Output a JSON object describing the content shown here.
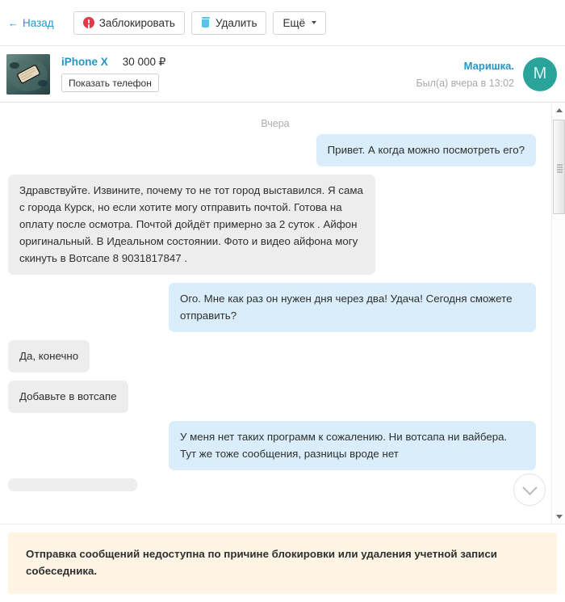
{
  "toolbar": {
    "back_label": "← Назад",
    "back_arrow": "←",
    "back_text": "Назад",
    "block_label": "Заблокировать",
    "delete_label": "Удалить",
    "more_label": "Ещё",
    "block_icon": "block-circle-icon",
    "delete_icon": "trash-icon",
    "more_icon": "chevron-down-icon"
  },
  "item": {
    "thumbnail_alt": "iPhone X photo",
    "title": "iPhone X",
    "price": "30 000 ₽",
    "show_phone_label": "Показать телефон"
  },
  "user": {
    "name": "Маришка.",
    "last_seen": "Был(а) вчера в 13:02",
    "avatar_initial": "M",
    "avatar_color": "#2aa39a"
  },
  "chat": {
    "day_separator": "Вчера",
    "messages": [
      {
        "side": "out",
        "text": "Привет. А когда можно посмотреть его?"
      },
      {
        "side": "in",
        "text": "Здравствуйте. Извините, почему то не тот город выставился. Я сама с города Курск, но если хотите могу отправить почтой. Готова на оплату после осмотра. Почтой дойдёт примерно за 2 суток . Айфон оригинальный. В Идеальном состоянии. Фото и видео айфона могу скинуть в Вотсапе 8 9031817847 ."
      },
      {
        "side": "out",
        "text": "Ого. Мне как раз он нужен дня через два! Удача! Сегодня сможете отправить?"
      },
      {
        "side": "in",
        "text": "Да, конечно"
      },
      {
        "side": "in",
        "text": "Добавьте в вотсапе"
      },
      {
        "side": "out",
        "text": "У меня нет таких программ к сожалению. Ни вотсапа ни вайбера. Тут же тоже сообщения, разницы вроде нет"
      },
      {
        "side": "in",
        "text": ""
      }
    ],
    "scroll_to_bottom_icon": "chevron-down-icon"
  },
  "scrollbar": {
    "up_icon": "triangle-up-icon",
    "down_icon": "triangle-down-icon"
  },
  "notice": {
    "text": "Отправка сообщений недоступна по причине блокировки или удаления учетной записи собеседника.",
    "background_color": "#fdf4e3"
  },
  "colors": {
    "link": "#2196c9",
    "outgoing_bubble": "#d9eefa",
    "incoming_bubble": "#ededed",
    "danger": "#e8374a",
    "trash": "#59c3e8"
  }
}
